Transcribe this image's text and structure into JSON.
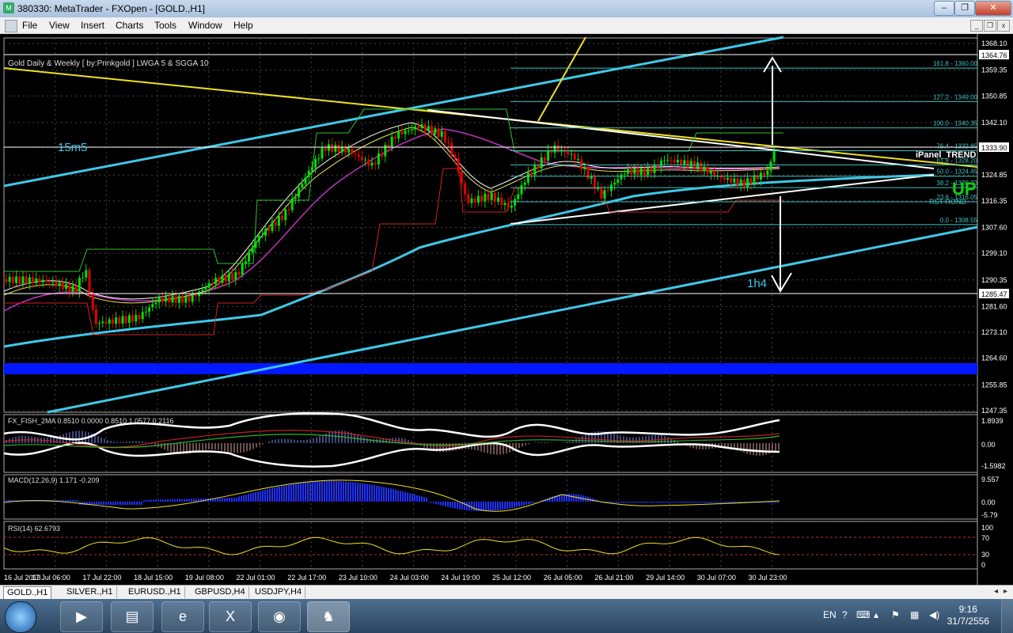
{
  "window": {
    "title": "380330: MetaTrader - FXOpen - [GOLD.,H1]"
  },
  "menu": [
    "File",
    "View",
    "Insert",
    "Charts",
    "Tools",
    "Window",
    "Help"
  ],
  "chart": {
    "indicator_label": "Gold Daily & Weekly [ by:Prinkgold ]  LWGA 5  &  SGGA 10",
    "label_15m5": "15m5",
    "label_1h4": "1h4",
    "ipanel_label": "iPanel_TREND",
    "ipanel_value": "UP",
    "rst_label": "RST-ROND",
    "y_ticks": [
      "1368.10",
      "1359.35",
      "1350.85",
      "1342.10",
      "1333.90",
      "1324.85",
      "1316.35",
      "1307.60",
      "1299.10",
      "1290.35",
      "1281.60",
      "1273.10",
      "1264.60",
      "1255.85",
      "1247.35"
    ],
    "price_tags": {
      "top": "1364.76",
      "current": "1333.90",
      "low": "1285.47"
    },
    "fib_levels": [
      {
        "label": "161.8 - 1360.00",
        "price": 1360.0
      },
      {
        "label": "127.2 - 1349.00",
        "price": 1349.0
      },
      {
        "label": "100.0 - 1340.35",
        "price": 1340.35
      },
      {
        "label": "76.4 - 1332.85",
        "price": 1332.85
      },
      {
        "label": "61.8 - 1328.20",
        "price": 1328.2
      },
      {
        "label": "50.0 - 1324.45",
        "price": 1324.45
      },
      {
        "label": "38.2 - 1320.70",
        "price": 1320.7
      },
      {
        "label": "23.6 - 1316.05",
        "price": 1316.05
      },
      {
        "label": "0.0 - 1308.55",
        "price": 1308.55
      }
    ],
    "x_ticks": [
      "16 Jul 2013",
      "17 Jul 06:00",
      "17 Jul 22:00",
      "18 Jul 15:00",
      "19 Jul 08:00",
      "22 Jul 01:00",
      "22 Jul 17:00",
      "23 Jul 10:00",
      "24 Jul 03:00",
      "24 Jul 19:00",
      "25 Jul 12:00",
      "26 Jul 05:00",
      "26 Jul 21:00",
      "29 Jul 14:00",
      "30 Jul 07:00",
      "30 Jul 23:00"
    ]
  },
  "fisher": {
    "label": "FX_FISH_2MA 0.8510 0.0000 0.8510 1.0577 0.2116",
    "ticks": [
      "1.8939",
      "0.00",
      "-1.5982"
    ]
  },
  "macd": {
    "label": "MACD(12,26,9) 1.171 -0.209",
    "ticks": [
      "9.557",
      "0.00",
      "-5.79"
    ]
  },
  "rsi": {
    "label": "RSI(14) 62.6793",
    "ticks": [
      "100",
      "70",
      "30",
      "0"
    ]
  },
  "tabs": [
    "GOLD.,H1",
    "SILVER.,H1",
    "EURUSD.,H1",
    "GBPUSD,H4",
    "USDJPY,H4"
  ],
  "taskbar": {
    "lang": "EN",
    "time": "9:16",
    "date": "31/7/2556"
  },
  "colors": {
    "bull": "#00e000",
    "bear": "#e00000",
    "trend": "#40c0e0",
    "yellow": "#f0e020",
    "fib": "#40c0c0",
    "blue_band": "#0018ff"
  }
}
